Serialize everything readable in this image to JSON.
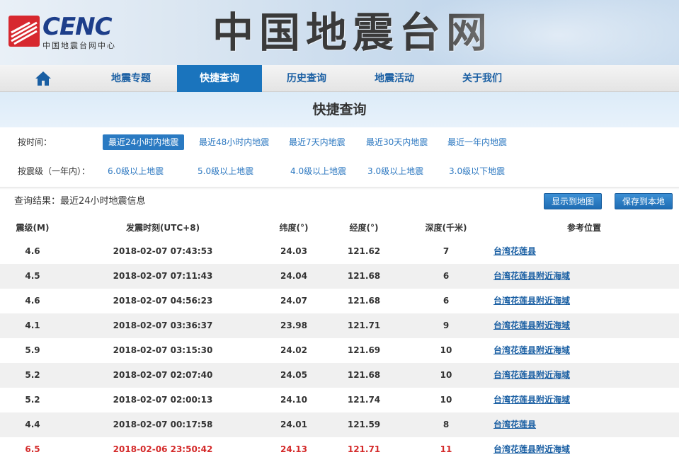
{
  "header": {
    "logo_text": "CENC",
    "logo_subtitle": "中国地震台网中心",
    "site_title": "中国地震台网"
  },
  "nav": {
    "items": [
      {
        "label": "地震专题",
        "active": false
      },
      {
        "label": "快捷查询",
        "active": true
      },
      {
        "label": "历史查询",
        "active": false
      },
      {
        "label": "地震活动",
        "active": false
      },
      {
        "label": "关于我们",
        "active": false
      }
    ]
  },
  "page_title": "快捷查询",
  "filters": {
    "time": {
      "label": "按时间：",
      "options": [
        "最近24小时内地震",
        "最近48小时内地震",
        "最近7天内地震",
        "最近30天内地震",
        "最近一年内地震"
      ],
      "selected": "最近24小时内地震"
    },
    "magnitude": {
      "label": "按震级（一年内）：",
      "options": [
        "6.0级以上地震",
        "5.0级以上地震",
        "4.0级以上地震",
        "3.0级以上地震",
        "3.0级以下地震"
      ]
    }
  },
  "results": {
    "label": "查询结果：最近24小时地震信息",
    "show_map_button": "显示到地图",
    "save_button": "保存到本地"
  },
  "table": {
    "headers": [
      "震级(M)",
      "发震时刻(UTC+8)",
      "纬度(°)",
      "经度(°)",
      "深度(千米)",
      "参考位置"
    ],
    "rows": [
      {
        "mag": "4.6",
        "time": "2018-02-07 07:43:53",
        "lat": "24.03",
        "lon": "121.62",
        "depth": "7",
        "loc": "台湾花莲县",
        "highlight": false
      },
      {
        "mag": "4.5",
        "time": "2018-02-07 07:11:43",
        "lat": "24.04",
        "lon": "121.68",
        "depth": "6",
        "loc": "台湾花莲县附近海域",
        "highlight": false
      },
      {
        "mag": "4.6",
        "time": "2018-02-07 04:56:23",
        "lat": "24.07",
        "lon": "121.68",
        "depth": "6",
        "loc": "台湾花莲县附近海域",
        "highlight": false
      },
      {
        "mag": "4.1",
        "time": "2018-02-07 03:36:37",
        "lat": "23.98",
        "lon": "121.71",
        "depth": "9",
        "loc": "台湾花莲县附近海域",
        "highlight": false
      },
      {
        "mag": "5.9",
        "time": "2018-02-07 03:15:30",
        "lat": "24.02",
        "lon": "121.69",
        "depth": "10",
        "loc": "台湾花莲县附近海域",
        "highlight": false
      },
      {
        "mag": "5.2",
        "time": "2018-02-07 02:07:40",
        "lat": "24.05",
        "lon": "121.68",
        "depth": "10",
        "loc": "台湾花莲县附近海域",
        "highlight": false
      },
      {
        "mag": "5.2",
        "time": "2018-02-07 02:00:13",
        "lat": "24.10",
        "lon": "121.74",
        "depth": "10",
        "loc": "台湾花莲县附近海域",
        "highlight": false
      },
      {
        "mag": "4.4",
        "time": "2018-02-07 00:17:58",
        "lat": "24.01",
        "lon": "121.59",
        "depth": "8",
        "loc": "台湾花莲县",
        "highlight": false
      },
      {
        "mag": "6.5",
        "time": "2018-02-06 23:50:42",
        "lat": "24.13",
        "lon": "121.71",
        "depth": "11",
        "loc": "台湾花莲县附近海域",
        "highlight": true
      }
    ]
  },
  "colors": {
    "accent": "#1a74bd",
    "link": "#1a5fa3",
    "highlight_text": "#d42a2a",
    "row_alt": "#f0f0f0"
  },
  "icons": {
    "nav_home": "home-icon",
    "logo_mark": "cenc-logo-icon"
  }
}
